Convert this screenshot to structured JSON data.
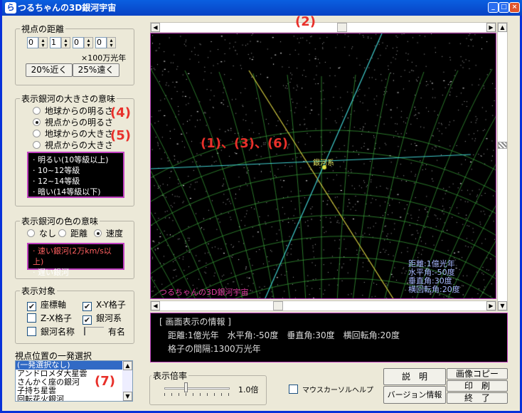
{
  "window": {
    "title": "つるちゃんの3D銀河宇宙",
    "min": "_",
    "max": "□",
    "close": "×"
  },
  "distance": {
    "label": "視点の距離",
    "digits": [
      "0",
      "1",
      "0",
      "0"
    ],
    "unit": "×100万光年",
    "closer": "20%近く",
    "farther": "25%遠く"
  },
  "size_meaning": {
    "label": "表示銀河の大きさの意味",
    "options": [
      {
        "label": "地球からの明るさ",
        "selected": false
      },
      {
        "label": "視点からの明るさ",
        "selected": true
      },
      {
        "label": "地球からの大きさ",
        "selected": false
      },
      {
        "label": "視点からの大きさ",
        "selected": false
      }
    ],
    "legend": [
      "明るい(10等級以上)",
      "10~12等級",
      "12~14等級",
      "暗い(14等級以下)"
    ]
  },
  "color_meaning": {
    "label": "表示銀河の色の意味",
    "options": [
      {
        "label": "なし",
        "selected": false
      },
      {
        "label": "距離",
        "selected": false
      },
      {
        "label": "速度",
        "selected": true
      }
    ],
    "legend": [
      "速い銀河(2万km/s以上)",
      "遅い銀河"
    ],
    "fast_color": "#ff6060"
  },
  "display_target": {
    "label": "表示対象",
    "items": [
      {
        "label": "座標軸",
        "checked": true
      },
      {
        "label": "X-Y格子",
        "checked": true
      },
      {
        "label": "Z-X格子",
        "checked": false
      },
      {
        "label": "銀河系",
        "checked": true
      },
      {
        "label": "銀河名称",
        "checked": false
      }
    ],
    "name_level": "有名"
  },
  "viewpoint": {
    "label": "視点位置の一発選択",
    "items": [
      "(一発選択なし)",
      "アンドロメダ大星雲",
      "さんかく座の銀河",
      "子持ち星雲",
      "回転花火銀河"
    ],
    "selected": 0
  },
  "annotations": {
    "a2": "(2)",
    "a4": "(4)",
    "a5": "(5)",
    "a136": "(1)、(3)、(6)",
    "a7": "(7)"
  },
  "view": {
    "milky_way": "銀河系",
    "app_label": "つるちゃんの3D銀河宇宙",
    "readout": [
      "距離:1億光年",
      "水平角:-50度",
      "垂直角:30度",
      "横回転角:20度"
    ]
  },
  "info": {
    "title": "[ 画面表示の情報 ]",
    "line1": "距離:1億光年　水平角:-50度　垂直角:30度　横回転角:20度",
    "line2": "格子の間隔:1300万光年"
  },
  "zoom": {
    "label": "表示倍率",
    "value": "1.0倍"
  },
  "mouse_help": {
    "label": "マウスカーソルヘルプ",
    "checked": false
  },
  "buttons": {
    "explain": "説　明",
    "version": "バージョン情報",
    "copy": "画像コピー",
    "print": "印　刷",
    "exit": "終　了"
  }
}
